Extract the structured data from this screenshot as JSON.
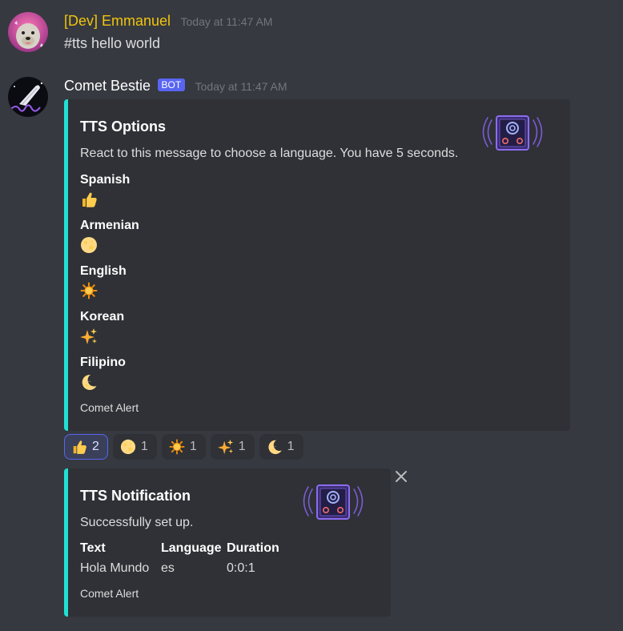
{
  "messages": [
    {
      "author": "[Dev] Emmanuel",
      "author_color": "#f1c40f",
      "timestamp": "Today at 11:47 AM",
      "content": "#tts hello world"
    },
    {
      "author": "Comet Bestie",
      "author_color": "#ffffff",
      "bot_tag": "BOT",
      "timestamp": "Today at 11:47 AM"
    }
  ],
  "embed_options": {
    "title": "TTS Options",
    "description": "React to this message to choose a language. You have 5 seconds.",
    "accent_color": "#1fe0d3",
    "fields": [
      {
        "name": "Spanish",
        "emoji": "thumbs-up-icon"
      },
      {
        "name": "Armenian",
        "emoji": "full-moon-icon"
      },
      {
        "name": "English",
        "emoji": "sun-icon"
      },
      {
        "name": "Korean",
        "emoji": "sparkles-icon"
      },
      {
        "name": "Filipino",
        "emoji": "crescent-moon-icon"
      }
    ],
    "footer": "Comet Alert",
    "thumbnail": "speaker-icon"
  },
  "reactions": [
    {
      "emoji": "thumbs-up-icon",
      "count": "2",
      "active": true
    },
    {
      "emoji": "full-moon-icon",
      "count": "1",
      "active": false
    },
    {
      "emoji": "sun-icon",
      "count": "1",
      "active": false
    },
    {
      "emoji": "sparkles-icon",
      "count": "1",
      "active": false
    },
    {
      "emoji": "crescent-moon-icon",
      "count": "1",
      "active": false
    }
  ],
  "embed_notification": {
    "title": "TTS Notification",
    "description": "Successfully set up.",
    "accent_color": "#1fe0d3",
    "fields": [
      {
        "name": "Text",
        "value": "Hola Mundo"
      },
      {
        "name": "Language",
        "value": "es"
      },
      {
        "name": "Duration",
        "value": "0:0:1"
      }
    ],
    "footer": "Comet Alert",
    "thumbnail": "speaker-icon"
  }
}
